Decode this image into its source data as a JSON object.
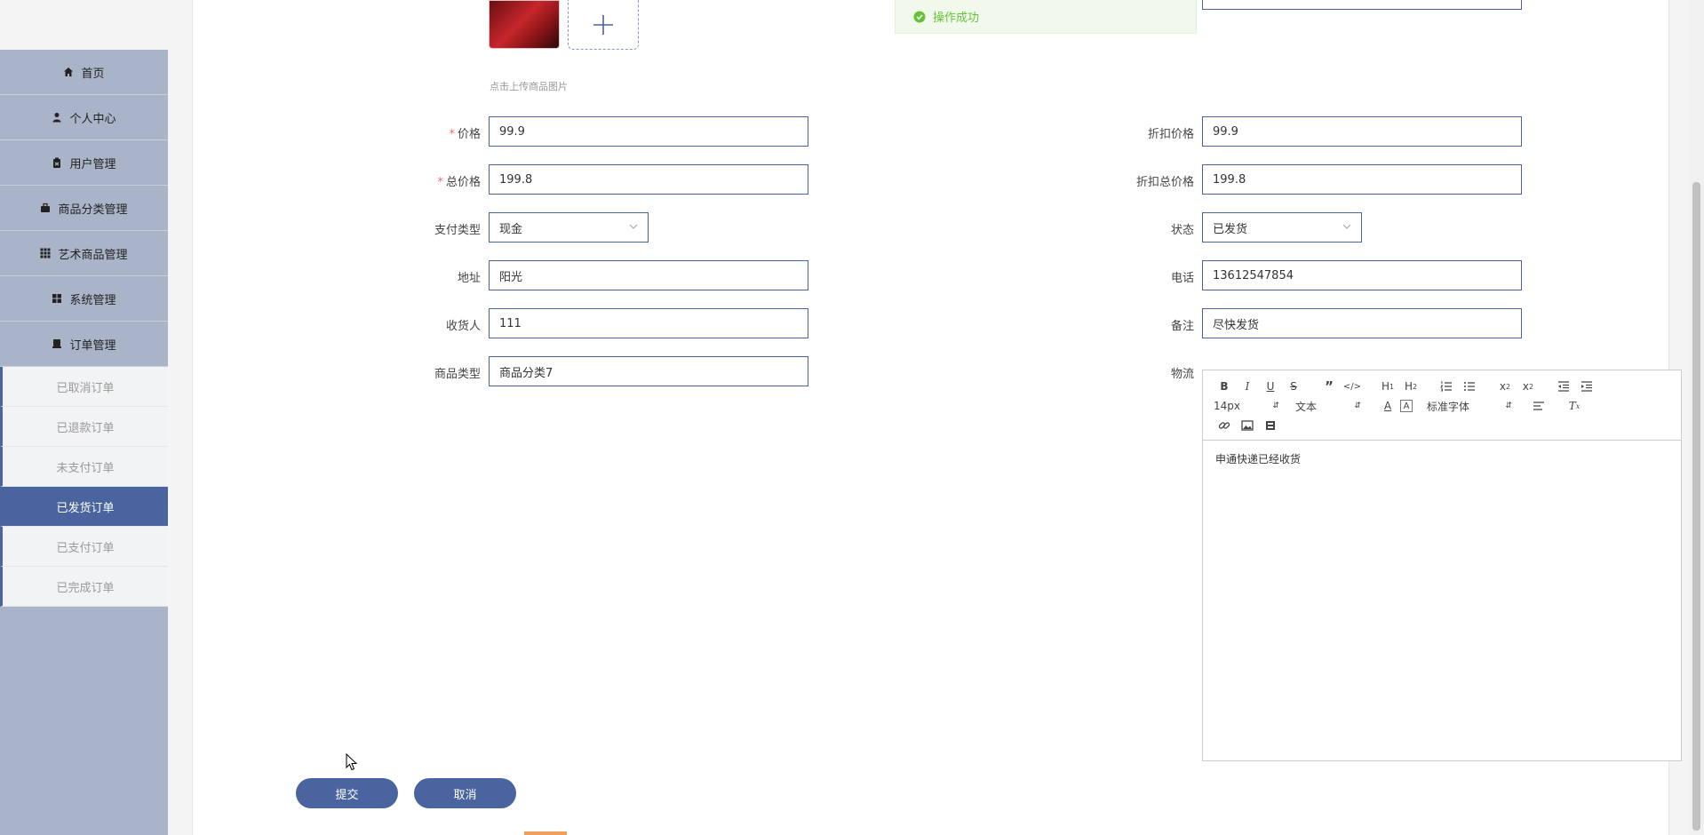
{
  "sidebar": {
    "items": [
      {
        "label": "首页",
        "icon": "home-icon"
      },
      {
        "label": "个人中心",
        "icon": "user-icon"
      },
      {
        "label": "用户管理",
        "icon": "clipboard-icon"
      },
      {
        "label": "商品分类管理",
        "icon": "briefcase-icon"
      },
      {
        "label": "艺术商品管理",
        "icon": "grid-icon"
      },
      {
        "label": "系统管理",
        "icon": "apps-icon"
      },
      {
        "label": "订单管理",
        "icon": "order-icon"
      }
    ],
    "subitems": [
      {
        "label": "已取消订单"
      },
      {
        "label": "已退款订单"
      },
      {
        "label": "未支付订单"
      },
      {
        "label": "已发货订单",
        "active": true
      },
      {
        "label": "已支付订单"
      },
      {
        "label": "已完成订单"
      }
    ]
  },
  "toast": {
    "text": "操作成功"
  },
  "upload": {
    "hint": "点击上传商品图片"
  },
  "form": {
    "price": {
      "label": "价格",
      "value": "99.9"
    },
    "discount_price": {
      "label": "折扣价格",
      "value": "99.9"
    },
    "total_price": {
      "label": "总价格",
      "value": "199.8"
    },
    "discount_total_price": {
      "label": "折扣总价格",
      "value": "199.8"
    },
    "payment_type": {
      "label": "支付类型",
      "value": "现金"
    },
    "status": {
      "label": "状态",
      "value": "已发货"
    },
    "address": {
      "label": "地址",
      "value": "阳光"
    },
    "phone": {
      "label": "电话",
      "value": "13612547854"
    },
    "receiver": {
      "label": "收货人",
      "value": "111"
    },
    "remark": {
      "label": "备注",
      "value": "尽快发货"
    },
    "category": {
      "label": "商品类型",
      "value": "商品分类7"
    },
    "logistics": {
      "label": "物流",
      "font_size": "14px",
      "block_type": "文本",
      "font_family": "标准字体",
      "content": "申通快递已经收货"
    }
  },
  "buttons": {
    "submit": "提交",
    "cancel": "取消"
  },
  "colors": {
    "primary": "#4a64a0",
    "sidebar": "#aab4c8",
    "success": "#67c23a",
    "required": "#f56c6c"
  }
}
